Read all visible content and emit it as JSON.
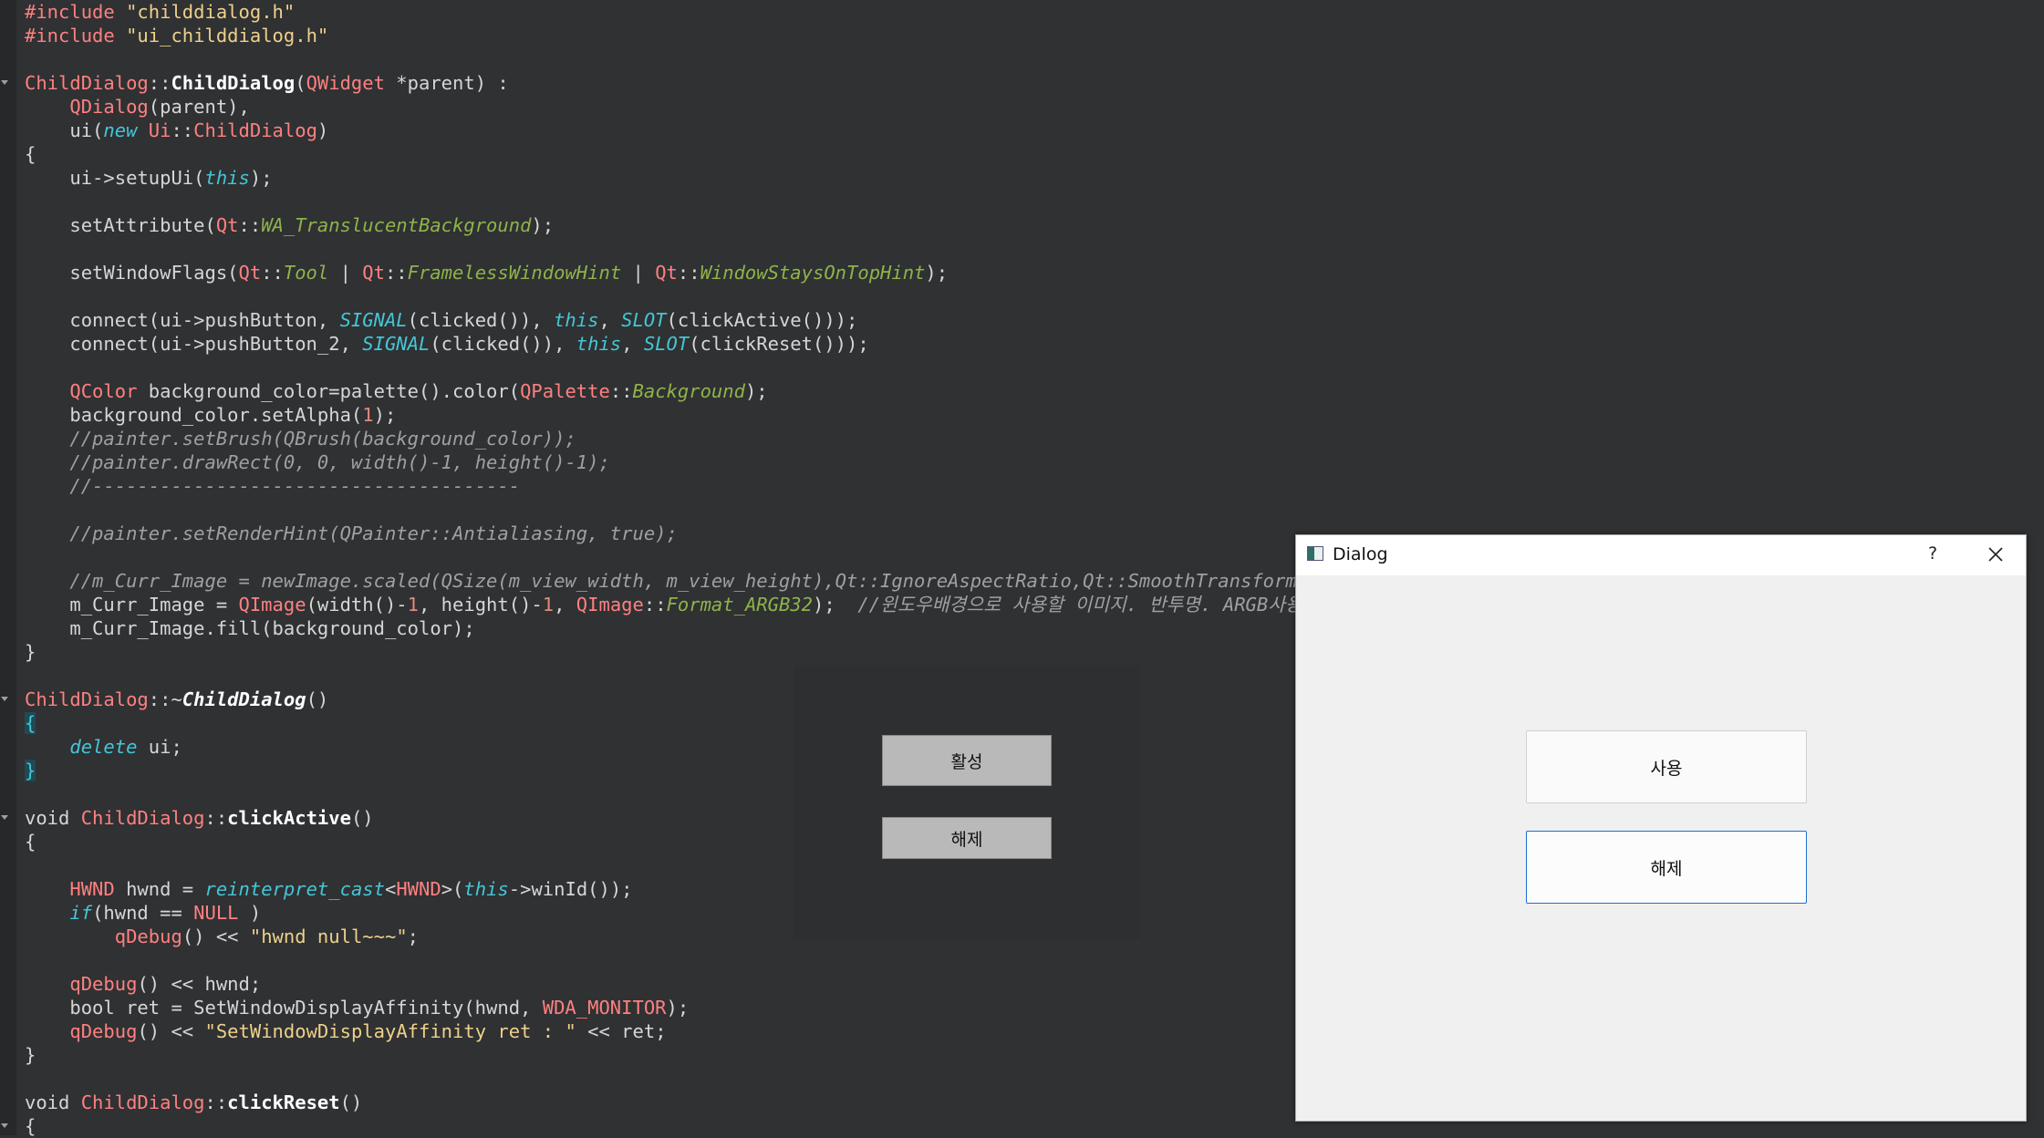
{
  "code_lines": [
    [
      [
        "t",
        "#include"
      ],
      [
        "p",
        " "
      ],
      [
        "str",
        "\"childdialog.h\""
      ]
    ],
    [
      [
        "t",
        "#include"
      ],
      [
        "p",
        " "
      ],
      [
        "str",
        "\"ui_childdialog.h\""
      ]
    ],
    [],
    [
      [
        "t",
        "ChildDialog"
      ],
      [
        "p",
        "::"
      ],
      [
        "fnb",
        "ChildDialog"
      ],
      [
        "p",
        "("
      ],
      [
        "t",
        "QWidget"
      ],
      [
        "p",
        " *parent) :"
      ]
    ],
    [
      [
        "p",
        "    "
      ],
      [
        "t",
        "QDialog"
      ],
      [
        "p",
        "(parent),"
      ]
    ],
    [
      [
        "p",
        "    ui("
      ],
      [
        "kw",
        "new"
      ],
      [
        "p",
        " "
      ],
      [
        "t",
        "Ui"
      ],
      [
        "p",
        "::"
      ],
      [
        "t",
        "ChildDialog"
      ],
      [
        "p",
        ")"
      ]
    ],
    [
      [
        "p",
        "{"
      ]
    ],
    [
      [
        "p",
        "    ui->setupUi("
      ],
      [
        "kw",
        "this"
      ],
      [
        "p",
        ");"
      ]
    ],
    [],
    [
      [
        "p",
        "    setAttribute("
      ],
      [
        "t",
        "Qt"
      ],
      [
        "p",
        "::"
      ],
      [
        "en",
        "WA_TranslucentBackground"
      ],
      [
        "p",
        ");"
      ]
    ],
    [],
    [
      [
        "p",
        "    setWindowFlags("
      ],
      [
        "t",
        "Qt"
      ],
      [
        "p",
        "::"
      ],
      [
        "en",
        "Tool"
      ],
      [
        "p",
        " | "
      ],
      [
        "t",
        "Qt"
      ],
      [
        "p",
        "::"
      ],
      [
        "en",
        "FramelessWindowHint"
      ],
      [
        "p",
        " | "
      ],
      [
        "t",
        "Qt"
      ],
      [
        "p",
        "::"
      ],
      [
        "en",
        "WindowStaysOnTopHint"
      ],
      [
        "p",
        ");"
      ]
    ],
    [],
    [
      [
        "p",
        "    connect(ui->pushButton, "
      ],
      [
        "kw",
        "SIGNAL"
      ],
      [
        "p",
        "(clicked()), "
      ],
      [
        "kw",
        "this"
      ],
      [
        "p",
        ", "
      ],
      [
        "kw",
        "SLOT"
      ],
      [
        "p",
        "(clickActive()));"
      ]
    ],
    [
      [
        "p",
        "    connect(ui->pushButton_2, "
      ],
      [
        "kw",
        "SIGNAL"
      ],
      [
        "p",
        "(clicked()), "
      ],
      [
        "kw",
        "this"
      ],
      [
        "p",
        ", "
      ],
      [
        "kw",
        "SLOT"
      ],
      [
        "p",
        "(clickReset()));"
      ]
    ],
    [],
    [
      [
        "p",
        "    "
      ],
      [
        "t",
        "QColor"
      ],
      [
        "p",
        " background_color=palette().color("
      ],
      [
        "t",
        "QPalette"
      ],
      [
        "p",
        "::"
      ],
      [
        "en",
        "Background"
      ],
      [
        "p",
        ");"
      ]
    ],
    [
      [
        "p",
        "    background_color.setAlpha("
      ],
      [
        "num",
        "1"
      ],
      [
        "p",
        ");"
      ]
    ],
    [
      [
        "p",
        "    "
      ],
      [
        "cm",
        "//painter.setBrush(QBrush(background_color));"
      ]
    ],
    [
      [
        "p",
        "    "
      ],
      [
        "cm",
        "//painter.drawRect(0, 0, width()-1, height()-1);"
      ]
    ],
    [
      [
        "p",
        "    "
      ],
      [
        "cm",
        "//--------------------------------------"
      ]
    ],
    [],
    [
      [
        "p",
        "    "
      ],
      [
        "cm",
        "//painter.setRenderHint(QPainter::Antialiasing, true);"
      ]
    ],
    [],
    [
      [
        "p",
        "    "
      ],
      [
        "cm",
        "//m_Curr_Image = newImage.scaled(QSize(m_view_width, m_view_height),Qt::IgnoreAspectRatio,Qt::SmoothTransformation);"
      ]
    ],
    [
      [
        "p",
        "    m_Curr_Image = "
      ],
      [
        "t",
        "QImage"
      ],
      [
        "p",
        "(width()-"
      ],
      [
        "num",
        "1"
      ],
      [
        "p",
        ", height()-"
      ],
      [
        "num",
        "1"
      ],
      [
        "p",
        ", "
      ],
      [
        "t",
        "QImage"
      ],
      [
        "p",
        "::"
      ],
      [
        "en",
        "Format_ARGB32"
      ],
      [
        "p",
        ");  "
      ],
      [
        "cm",
        "//윈도우배경으로 사용할 이미지. 반투명. ARGB사용"
      ]
    ],
    [
      [
        "p",
        "    m_Curr_Image.fill(background_color);"
      ]
    ],
    [
      [
        "p",
        "}"
      ]
    ],
    [],
    [
      [
        "t",
        "ChildDialog"
      ],
      [
        "p",
        "::~"
      ],
      [
        "fnbi",
        "ChildDialog"
      ],
      [
        "p",
        "()"
      ]
    ],
    [
      [
        "bh",
        "{"
      ]
    ],
    [
      [
        "p",
        "    "
      ],
      [
        "kw",
        "delete"
      ],
      [
        "p",
        " ui;"
      ]
    ],
    [
      [
        "bh",
        "}"
      ]
    ],
    [],
    [
      [
        "p",
        "void "
      ],
      [
        "t",
        "ChildDialog"
      ],
      [
        "p",
        "::"
      ],
      [
        "fnb",
        "clickActive"
      ],
      [
        "p",
        "()"
      ]
    ],
    [
      [
        "p",
        "{"
      ]
    ],
    [],
    [
      [
        "p",
        "    "
      ],
      [
        "t",
        "HWND"
      ],
      [
        "p",
        " hwnd = "
      ],
      [
        "kw",
        "reinterpret_cast"
      ],
      [
        "p",
        "<"
      ],
      [
        "t",
        "HWND"
      ],
      [
        "p",
        ">("
      ],
      [
        "kw",
        "this"
      ],
      [
        "p",
        "->winId());"
      ]
    ],
    [
      [
        "p",
        "    "
      ],
      [
        "kw",
        "if"
      ],
      [
        "p",
        "(hwnd == "
      ],
      [
        "t",
        "NULL"
      ],
      [
        "p",
        " )"
      ]
    ],
    [
      [
        "p",
        "        "
      ],
      [
        "t",
        "qDebug"
      ],
      [
        "p",
        "() << "
      ],
      [
        "str",
        "\"hwnd null~~~\""
      ],
      [
        "p",
        ";"
      ]
    ],
    [],
    [
      [
        "p",
        "    "
      ],
      [
        "t",
        "qDebug"
      ],
      [
        "p",
        "() << hwnd;"
      ]
    ],
    [
      [
        "p",
        "    bool ret = SetWindowDisplayAffinity(hwnd, "
      ],
      [
        "t",
        "WDA_MONITOR"
      ],
      [
        "p",
        ");"
      ]
    ],
    [
      [
        "p",
        "    "
      ],
      [
        "t",
        "qDebug"
      ],
      [
        "p",
        "() << "
      ],
      [
        "str",
        "\"SetWindowDisplayAffinity ret : \""
      ],
      [
        "p",
        " << ret;"
      ]
    ],
    [
      [
        "p",
        "}"
      ]
    ],
    [],
    [
      [
        "p",
        "void "
      ],
      [
        "t",
        "ChildDialog"
      ],
      [
        "p",
        "::"
      ],
      [
        "fnb",
        "clickReset"
      ],
      [
        "p",
        "()"
      ]
    ],
    [
      [
        "p",
        "{"
      ]
    ]
  ],
  "fold_markers": [
    3,
    29,
    34,
    47
  ],
  "translucent_widget": {
    "active_button": "활성",
    "reset_button": "해제"
  },
  "dialog": {
    "title": "Dialog",
    "help_label": "?",
    "use_button": "사용",
    "reset_button": "해제"
  },
  "colors": {
    "editor_bg": "#2f3133",
    "dialog_bg": "#f0f0f0",
    "focus_border": "#1f6fd0"
  }
}
